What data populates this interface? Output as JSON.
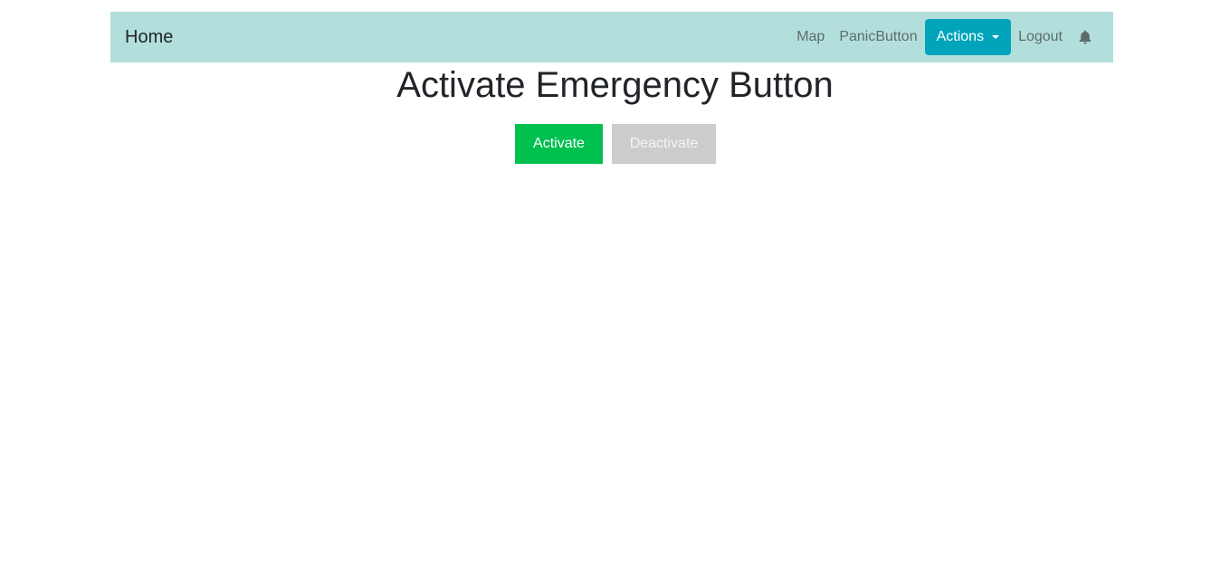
{
  "navbar": {
    "brand": "Home",
    "links": {
      "map": "Map",
      "panic": "PanicButton",
      "actions": "Actions",
      "logout": "Logout"
    },
    "bell_icon": "bell-icon",
    "background_color": "#b2dfdb",
    "actions_color": "#00a5bb"
  },
  "main": {
    "title": "Activate Emergency Button",
    "activate_label": "Activate",
    "deactivate_label": "Deactivate",
    "activate_color": "#00c050",
    "deactivate_color": "#cccccc"
  }
}
